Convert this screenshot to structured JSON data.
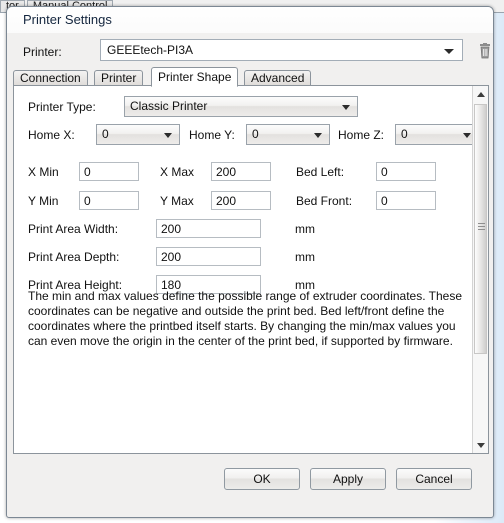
{
  "background": {
    "tabs": [
      {
        "label": "tor"
      },
      {
        "label": "Manual Control"
      }
    ]
  },
  "dialog": {
    "title": "Printer Settings",
    "printer_row": {
      "label": "Printer:",
      "selected": "GEEEtech-PI3A",
      "delete_icon": "trash-icon",
      "dropdown_icon": "chevron-down-icon"
    },
    "tabs": [
      {
        "label": "Connection",
        "selected": false
      },
      {
        "label": "Printer",
        "selected": false
      },
      {
        "label": "Printer Shape",
        "selected": true
      },
      {
        "label": "Advanced",
        "selected": false
      }
    ],
    "form": {
      "printer_type": {
        "label": "Printer Type:",
        "value": "Classic Printer"
      },
      "home_x": {
        "label": "Home X:",
        "value": "0"
      },
      "home_y": {
        "label": "Home Y:",
        "value": "0"
      },
      "home_z": {
        "label": "Home Z:",
        "value": "0"
      },
      "x_min": {
        "label": "X Min",
        "value": "0"
      },
      "y_min": {
        "label": "Y Min",
        "value": "0"
      },
      "x_max": {
        "label": "X Max",
        "value": "200"
      },
      "y_max": {
        "label": "Y Max",
        "value": "200"
      },
      "bed_left": {
        "label": "Bed Left:",
        "value": "0"
      },
      "bed_front": {
        "label": "Bed Front:",
        "value": "0"
      },
      "print_area_width": {
        "label": "Print Area Width:",
        "value": "200",
        "unit": "mm"
      },
      "print_area_depth": {
        "label": "Print Area Depth:",
        "value": "200",
        "unit": "mm"
      },
      "print_area_height": {
        "label": "Print Area Height:",
        "value": "180",
        "unit": "mm"
      },
      "help_text": "The min and max values define the possible range of extruder coordinates. These coordinates can be negative and outside the print bed. Bed left/front define the coordinates where the printbed itself starts. By changing the min/max values you can even move the origin in the center of the print bed, if supported by firmware."
    },
    "scrollbar": {
      "up_icon": "chevron-up-icon",
      "down_icon": "chevron-down-icon"
    },
    "buttons": {
      "ok": "OK",
      "apply": "Apply",
      "cancel": "Cancel"
    }
  },
  "colors": {
    "dialog_bg": "#f1f0ef",
    "panel_bg": "#ffffff",
    "border": "#8c949c",
    "text": "#111111",
    "title_text": "#14263e",
    "desktop_tint": "#dceaf8"
  }
}
